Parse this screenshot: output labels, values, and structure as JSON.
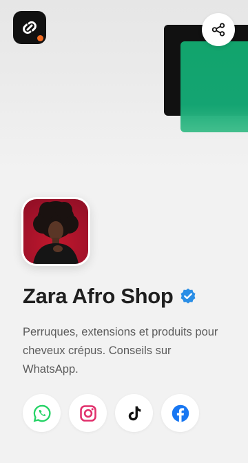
{
  "profile": {
    "name": "Zara Afro Shop",
    "bio": "Perruques, extensions et produits pour cheveux crépus. Conseils sur WhatsApp.",
    "verified": true
  },
  "icons": {
    "app_logo": "link-chain-icon",
    "share": "share-icon",
    "verified": "verified-badge-icon"
  },
  "socials": [
    {
      "name": "WhatsApp",
      "icon": "whatsapp-icon",
      "color": "#25D366"
    },
    {
      "name": "Instagram",
      "icon": "instagram-icon",
      "color": "#E1306C"
    },
    {
      "name": "TikTok",
      "icon": "tiktok-icon",
      "color": "#000000"
    },
    {
      "name": "Facebook",
      "icon": "facebook-icon",
      "color": "#1877F2"
    }
  ],
  "colors": {
    "accent_green": "#12a86f",
    "logo_dot": "#f26b21",
    "verified_blue": "#2a8ee6",
    "avatar_bg": "#a3122a"
  }
}
